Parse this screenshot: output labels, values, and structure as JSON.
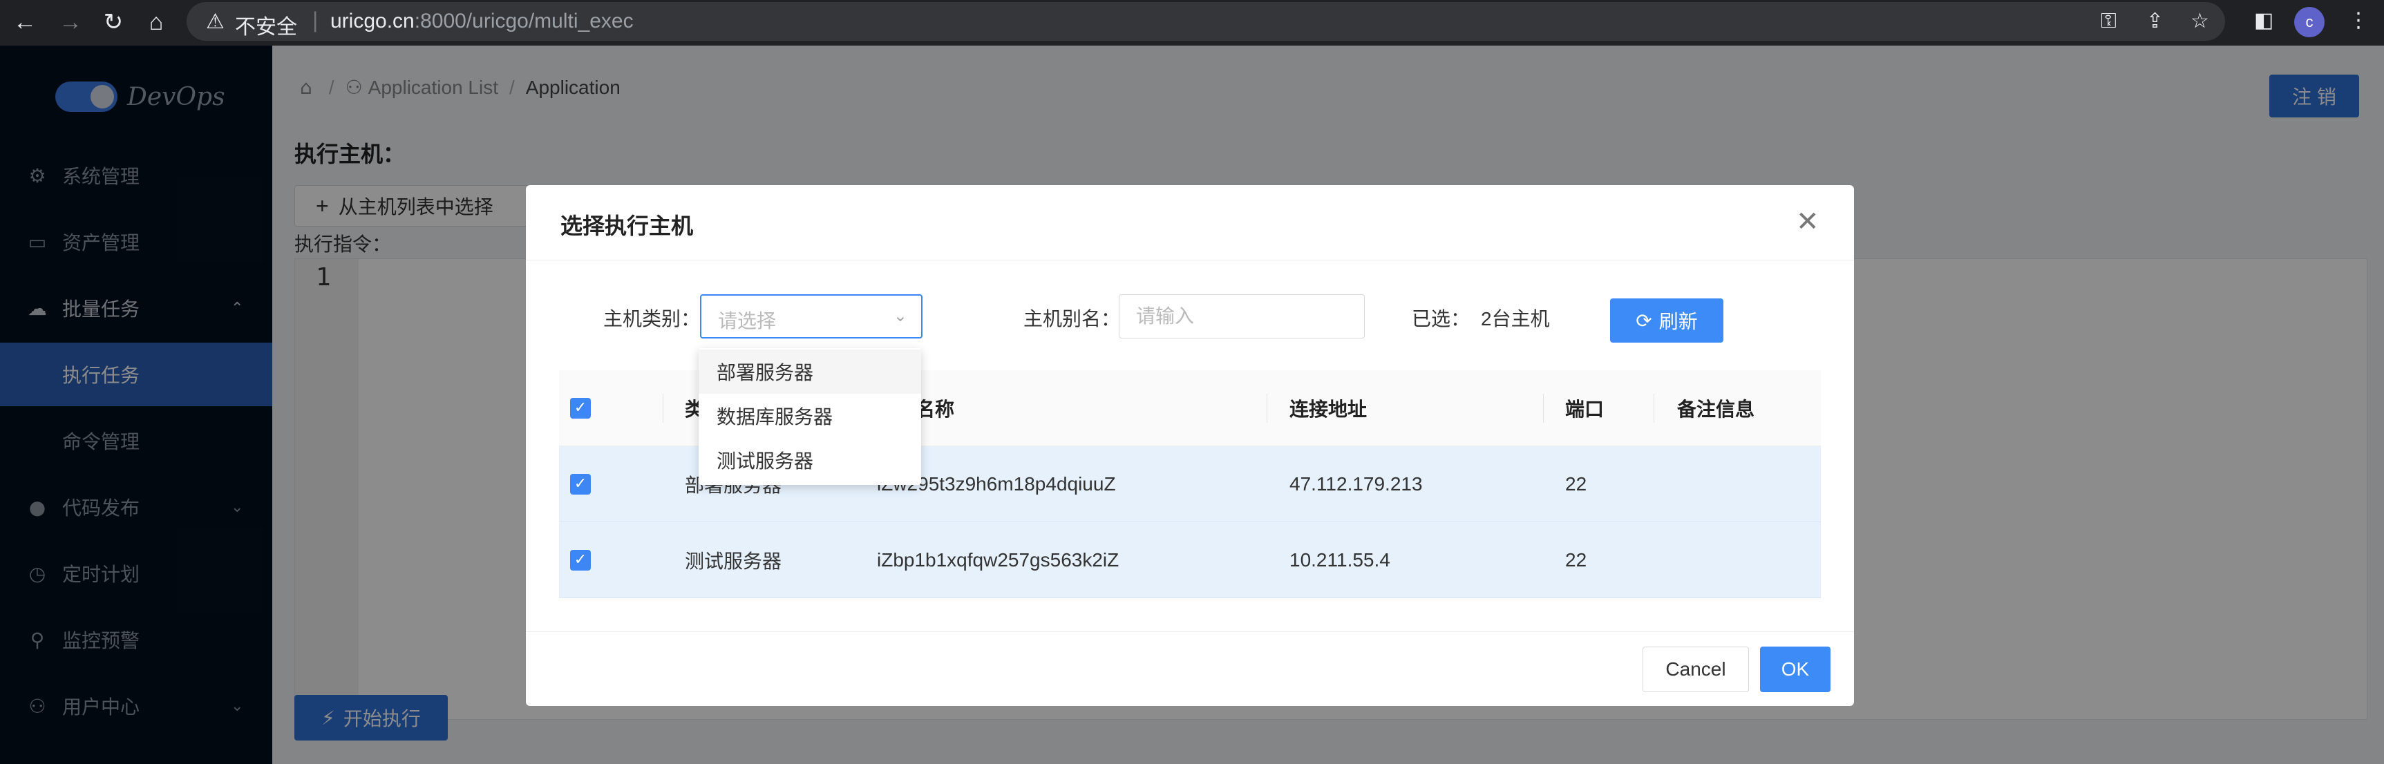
{
  "browser": {
    "insecure_label": "不安全",
    "url_host": "uricgo.cn",
    "url_path": ":8000/uricgo/multi_exec",
    "avatar_letter": "c"
  },
  "sidebar": {
    "logo_text": "DevOps",
    "items": [
      {
        "label": "系统管理",
        "icon": "gear-icon"
      },
      {
        "label": "资产管理",
        "icon": "monitor-icon"
      },
      {
        "label": "批量任务",
        "icon": "cloud-upload-icon",
        "expanded": true
      },
      {
        "label": "执行任务",
        "active": true
      },
      {
        "label": "命令管理"
      },
      {
        "label": "代码发布",
        "icon": "github-icon"
      },
      {
        "label": "定时计划",
        "icon": "clock-icon"
      },
      {
        "label": "监控预警",
        "icon": "search-icon"
      },
      {
        "label": "用户中心",
        "icon": "user-icon"
      }
    ]
  },
  "header": {
    "breadcrumb": [
      "Application List",
      "Application"
    ],
    "logout_label": "注 销"
  },
  "page": {
    "section_title": "执行主机：",
    "select_from_list_label": "从主机列表中选择",
    "cmd_label": "执行指令：",
    "editor_line": "1",
    "run_label": "开始执行"
  },
  "modal": {
    "title": "选择执行主机",
    "filter": {
      "category_label": "主机类别：",
      "category_placeholder": "请选择",
      "alias_label": "主机别名：",
      "alias_placeholder": "请输入",
      "selected_label": "已选：",
      "selected_value": "2台主机",
      "refresh_label": "刷新"
    },
    "dropdown_options": [
      "部署服务器",
      "数据库服务器",
      "测试服务器"
    ],
    "table": {
      "columns": [
        "类别",
        "主机名称",
        "连接地址",
        "端口",
        "备注信息"
      ],
      "header_partial_col0": "类",
      "header_partial_col1": "名称",
      "rows": [
        {
          "category": "部署服务器",
          "category_visible": "部署服务器",
          "name": "iZw295t3z9h6m18p4dqiuuZ",
          "name_visible": "iZw295t3z9h6m18p4dqiuuZ",
          "address": "47.112.179.213",
          "port": "22",
          "note": ""
        },
        {
          "category": "测试服务器",
          "category_visible": "测试服务器",
          "name": "iZbp1b1xqfqw257gs563k2iZ",
          "name_visible": "iZbp1b1xqfqw257gs563k2iZ",
          "address": "10.211.55.4",
          "port": "22",
          "note": ""
        }
      ]
    },
    "cancel_label": "Cancel",
    "ok_label": "OK"
  },
  "colors": {
    "accent": "#3d8bf7",
    "sidebar_bg": "#04101e",
    "active_menu": "#2a5fb8"
  }
}
